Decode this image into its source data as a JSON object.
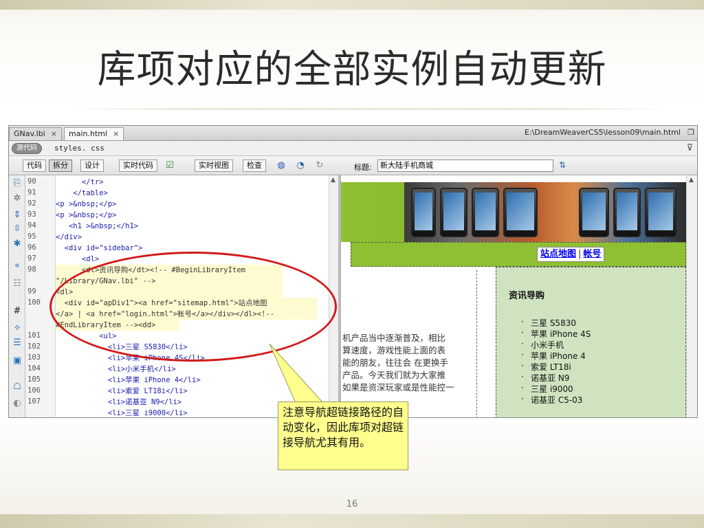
{
  "slide": {
    "title": "库项对应的全部实例自动更新",
    "page_number": "16",
    "callout": "注意导航超链接路径的自动变化，因此库项对超链接导航尤其有用。"
  },
  "window": {
    "tabs": [
      {
        "label": "GNav.lbi",
        "close": "×"
      },
      {
        "label": "main.html",
        "close": "×"
      }
    ],
    "path": "E:\\DreamWeaverCS5\\lesson09\\main.html",
    "related": {
      "source_label": "源代码",
      "styles_label": "styles. css"
    }
  },
  "toolbar": {
    "code_label": "代码",
    "split_label": "拆分",
    "design_label": "设计",
    "live_code_label": "实时代码",
    "live_view_label": "实时视图",
    "inspect_label": "检查",
    "title_label": "标题:",
    "title_value": "新大陆手机商城"
  },
  "code": {
    "line_numbers": [
      "90",
      "91",
      "92",
      "93",
      "94",
      "95",
      "96",
      "97",
      "98",
      "99",
      "100",
      "101",
      "102",
      "103",
      "104",
      "105",
      "106",
      "107"
    ],
    "lines": [
      "      </tr>",
      "    </table>",
      "<p >&nbsp;</p>",
      "<p >&nbsp;</p>",
      "   <h1 >&nbsp;</h1>",
      "</div>",
      "  <div id=\"sidebar\">",
      "      <dl>",
      "      <dt>资讯导购</dt><!-- #BeginLibraryItem",
      "\"/Library/GNav.lbi\" -->",
      "<dl>",
      "  <div id=\"apDiv1\"><a href=\"sitemap.html\">站点地图",
      "</a> | <a href=\"login.html\">帐号</a></div></dl><!--",
      "#EndLibraryItem --><dd>",
      "          <ul>",
      "            <li>三星 S5830</li>",
      "            <li>苹果 iPhone 4S</li>",
      "            <li>小米手机</li>",
      "            <li>苹果 iPhone 4</li>",
      "            <li>索爱 LT18i</li>",
      "            <li>诺基亚 N9</li>",
      "            <li>三星 i9000</li>"
    ]
  },
  "design": {
    "nav": {
      "sitemap": "站点地图",
      "separator": "|",
      "account": "帐号"
    },
    "paragraph": [
      "机产品当中逐渐普及，相比",
      "算速度，游戏性能上面的表",
      "能的朋友，往往会 在更换手",
      "产品。今天我们就为大家推",
      "如果是资深玩家或是性能控一"
    ],
    "sidebar_title": "资讯导购",
    "sidebar_items": [
      "三星 S5830",
      "苹果 iPhone 4S",
      "小米手机",
      "苹果 iPhone 4",
      "索爱 LT18i",
      "诺基亚 N9",
      "三星 i9000",
      "诺基亚 C5-03"
    ]
  },
  "colors": {
    "banner_green": "#8fbf32",
    "sidebar_bg": "#cfe3c0",
    "annotation_red": "#d11a1a",
    "callout_yellow": "#ffff8e"
  }
}
